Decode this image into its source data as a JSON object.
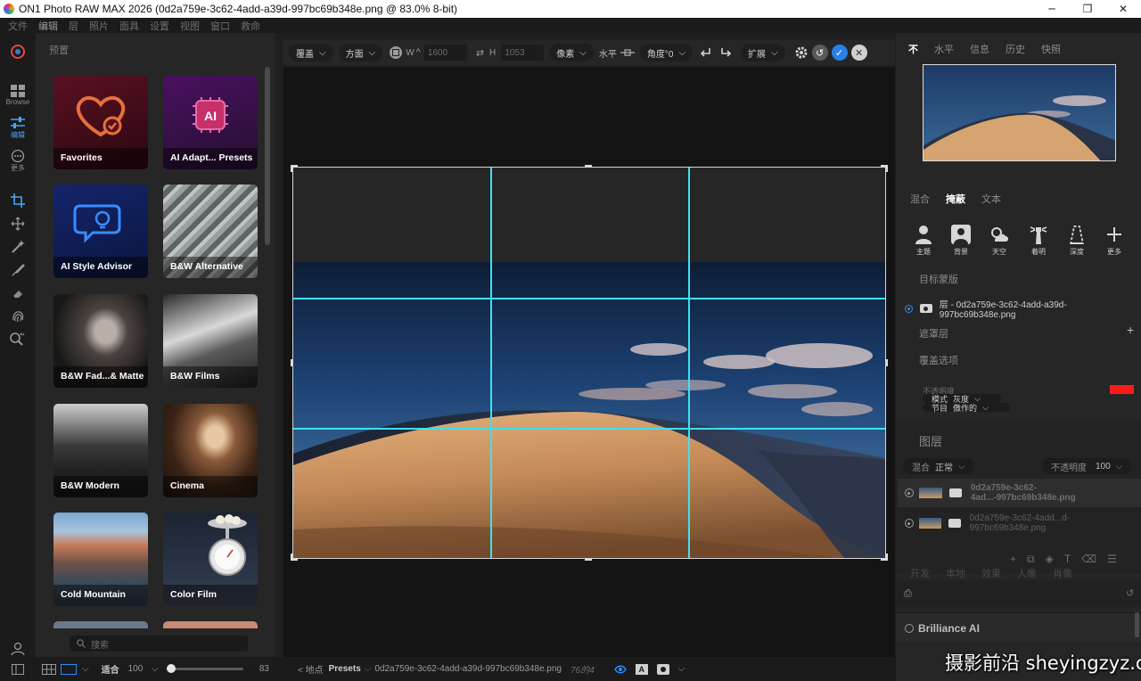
{
  "window": {
    "title": "ON1 Photo RAW MAX 2026 (0d2a759e-3c62-4add-a39d-997bc69b348e.png @ 83.0% 8-bit)",
    "controls": [
      "─",
      "❐",
      "✕"
    ]
  },
  "menu": [
    "文件",
    "编辑",
    "层",
    "照片",
    "面具",
    "设置",
    "视图",
    "窗口",
    "救命"
  ],
  "menu_active": "编辑",
  "rail": {
    "browse_label": "Browse",
    "edit_label": "编辑",
    "more_label": "更多"
  },
  "presets": {
    "header": "预置",
    "tiles": [
      {
        "label": "Favorites"
      },
      {
        "label": "AI Adapt... Presets"
      },
      {
        "label": "AI Style Advisor"
      },
      {
        "label": "B&W Alternative"
      },
      {
        "label": "B&W Fad...& Matte"
      },
      {
        "label": "B&W Films"
      },
      {
        "label": "B&W Modern"
      },
      {
        "label": "Cinema"
      },
      {
        "label": "Cold Mountain"
      },
      {
        "label": "Color Film"
      }
    ],
    "search_placeholder": "搜索"
  },
  "crop_toolbar": {
    "mode": "覆盖",
    "aspect": "方面",
    "w_label": "W",
    "w_value": "1600",
    "h_label": "H",
    "h_value": "1053",
    "unit": "像素",
    "level_label": "水平",
    "angle": "角度°0",
    "expand": "扩展"
  },
  "right_panel": {
    "top_tabs": [
      "不",
      "水平",
      "信息",
      "历史",
      "快照"
    ],
    "mask_tabs": [
      "混合",
      "掩蔽",
      "文本"
    ],
    "mask_tab_active": "掩蔽",
    "mask_tools": [
      {
        "label": "主题",
        "icon": "person-icon"
      },
      {
        "label": "背景",
        "icon": "portrait-frame-icon"
      },
      {
        "label": "天空",
        "icon": "cloud-sun-icon"
      },
      {
        "label": "着明",
        "icon": "lighthouse-icon"
      },
      {
        "label": "深度",
        "icon": "depth-icon"
      },
      {
        "label": "更多",
        "icon": "plus-icon"
      }
    ],
    "target_mask_label": "目标蒙版",
    "target_layer_name": "层 - 0d2a759e-3c62-4add-a39d-997bc69b348e.png",
    "mask_layer_label": "遮罩层",
    "overlay_options_label": "覆盖选项",
    "overlay_opacity_label": "不透明度",
    "overlay_mode_label": "模式",
    "overlay_mode_value": "灰度",
    "overlay_section_label": "节目",
    "overlay_section_value": "傲作的",
    "overlay_color": "#ff1a1a",
    "layers_label": "图层",
    "blend_label": "混合",
    "blend_value": "正常",
    "opacity_label": "不透明度",
    "opacity_value": "100",
    "layers": [
      {
        "name": "0d2a759e-3c62-4ad...-997bc69b348e.png"
      },
      {
        "name": "0d2a759e-3c62-4add...d-997bc69b348e.png"
      }
    ],
    "bottom_tabs": [
      "开发",
      "本地",
      "效果",
      "人像",
      "肖像"
    ],
    "brilliance_label": "Brilliance AI"
  },
  "bottom_bar": {
    "fit_label": "适合",
    "zoom_value": "100",
    "slider_value": "83",
    "slider_fraction": 0.02,
    "nav_text": "< 地点",
    "presets_label": "Presets",
    "file_name": "0d2a759e-3c62-4add-a39d-997bc69b348e.png",
    "file_size": "76的4"
  },
  "watermark": "摄影前沿 sheyingzyz.com"
}
